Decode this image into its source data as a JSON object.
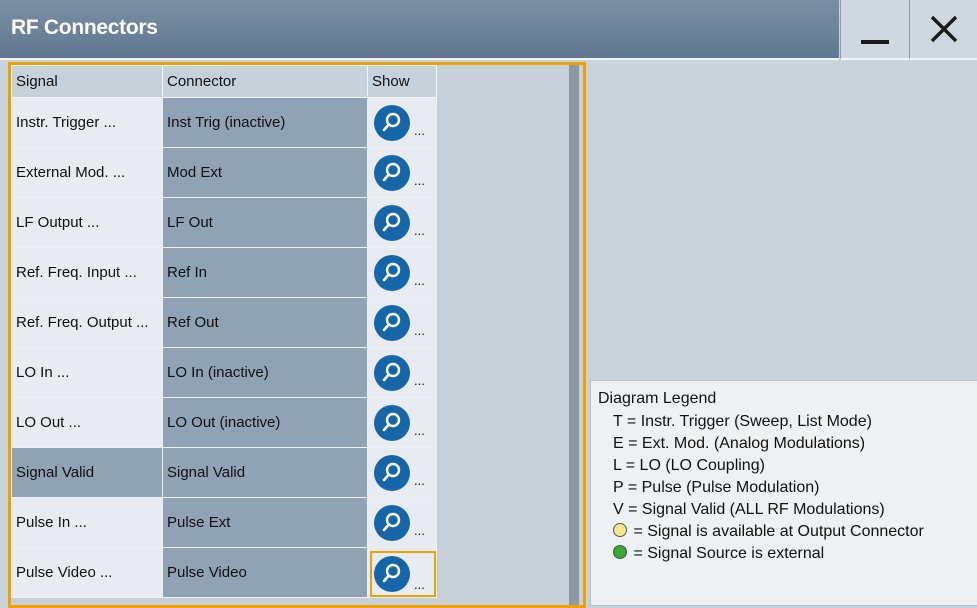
{
  "window": {
    "title": "RF Connectors",
    "minimize_icon": "minimize-icon",
    "close_icon": "close-icon"
  },
  "table": {
    "columns": [
      "Signal",
      "Connector",
      "Show"
    ],
    "rows": [
      {
        "signal": "Instr. Trigger ...",
        "connector": "Inst Trig (inactive)",
        "show": "..."
      },
      {
        "signal": "External Mod. ...",
        "connector": "Mod Ext",
        "show": "..."
      },
      {
        "signal": "LF Output ...",
        "connector": "LF Out",
        "show": "..."
      },
      {
        "signal": "Ref. Freq. Input ...",
        "connector": "Ref In",
        "show": "..."
      },
      {
        "signal": "Ref. Freq. Output ...",
        "connector": "Ref Out",
        "show": "..."
      },
      {
        "signal": "LO In ...",
        "connector": "LO In (inactive)",
        "show": "..."
      },
      {
        "signal": "LO Out ...",
        "connector": "LO Out (inactive)",
        "show": "..."
      },
      {
        "signal": "Signal Valid",
        "connector": "Signal Valid",
        "show": "..."
      },
      {
        "signal": "Pulse In ...",
        "connector": "Pulse Ext",
        "show": "..."
      },
      {
        "signal": "Pulse Video ...",
        "connector": "Pulse Video",
        "show": "..."
      }
    ],
    "show_icon": "search-icon"
  },
  "legend": {
    "title": "Diagram Legend",
    "items": [
      "T = Instr. Trigger (Sweep, List Mode)",
      "E = Ext. Mod. (Analog Modulations)",
      "L = LO (LO Coupling)",
      "P = Pulse (Pulse Modulation)",
      "V = Signal Valid (ALL RF Modulations)"
    ],
    "dot_items": [
      {
        "text": "= Signal is available at Output Connector",
        "color": "#f5e68a"
      },
      {
        "text": "= Signal Source is external",
        "color": "#2fae2f"
      }
    ]
  },
  "colors": {
    "accent": "#f0a000",
    "title_bar": "#6d849a",
    "search_button": "#1566a8"
  }
}
